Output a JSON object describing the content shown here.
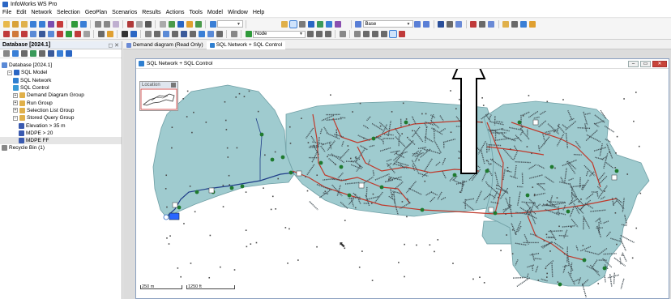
{
  "app": {
    "title": "InfoWorks WS Pro"
  },
  "menu": [
    "File",
    "Edit",
    "Network",
    "Selection",
    "GeoPlan",
    "Scenarios",
    "Results",
    "Actions",
    "Tools",
    "Model",
    "Window",
    "Help"
  ],
  "toolbar": {
    "scenario_value": "Base",
    "layer_value": "Node",
    "empty_combo_value": ""
  },
  "left_panel": {
    "title": "Database [2024.1]",
    "close_label": "✕",
    "pin_label": "◻"
  },
  "tree": [
    {
      "label": "Database [2024.1]",
      "indent": 0,
      "icon": "database-icon",
      "expander": ""
    },
    {
      "label": "SQL Model",
      "indent": 1,
      "icon": "model-group-icon",
      "expander": "−"
    },
    {
      "label": "SQL Network",
      "indent": 2,
      "icon": "network-icon",
      "expander": ""
    },
    {
      "label": "SQL Control",
      "indent": 2,
      "icon": "control-icon",
      "expander": ""
    },
    {
      "label": "Demand Diagram Group",
      "indent": 2,
      "icon": "folder-icon",
      "expander": "+"
    },
    {
      "label": "Run Group",
      "indent": 2,
      "icon": "folder-icon",
      "expander": "+"
    },
    {
      "label": "Selection List Group",
      "indent": 2,
      "icon": "folder-icon",
      "expander": "+"
    },
    {
      "label": "Stored Query Group",
      "indent": 2,
      "icon": "folder-icon",
      "expander": "−"
    },
    {
      "label": "Elevation > 35 m",
      "indent": 3,
      "icon": "query-icon",
      "expander": ""
    },
    {
      "label": "MDPE > 20",
      "indent": 3,
      "icon": "query-icon",
      "expander": ""
    },
    {
      "label": "MDPE FF",
      "indent": 3,
      "icon": "query-icon",
      "expander": "",
      "selected": true
    },
    {
      "label": "Recycle Bin (1)",
      "indent": 0,
      "icon": "recycle-bin-icon",
      "expander": ""
    }
  ],
  "tabs": [
    {
      "label": "Demand diagram (Read Only)"
    },
    {
      "label": "SQL Network + SQL Control",
      "active": true
    }
  ],
  "map_window": {
    "title": "SQL Network + SQL Control",
    "location_label": "Location",
    "scale_left": "250 m",
    "scale_right": "1250 ft"
  },
  "colors": {
    "zone_fill": "#9fcbcf",
    "pipe_main": "#c0392b",
    "pipe_trunk": "#1f3c88",
    "node": "#4a4a4a",
    "valve": "#1e7a2e",
    "accent": "#2a66c4"
  }
}
